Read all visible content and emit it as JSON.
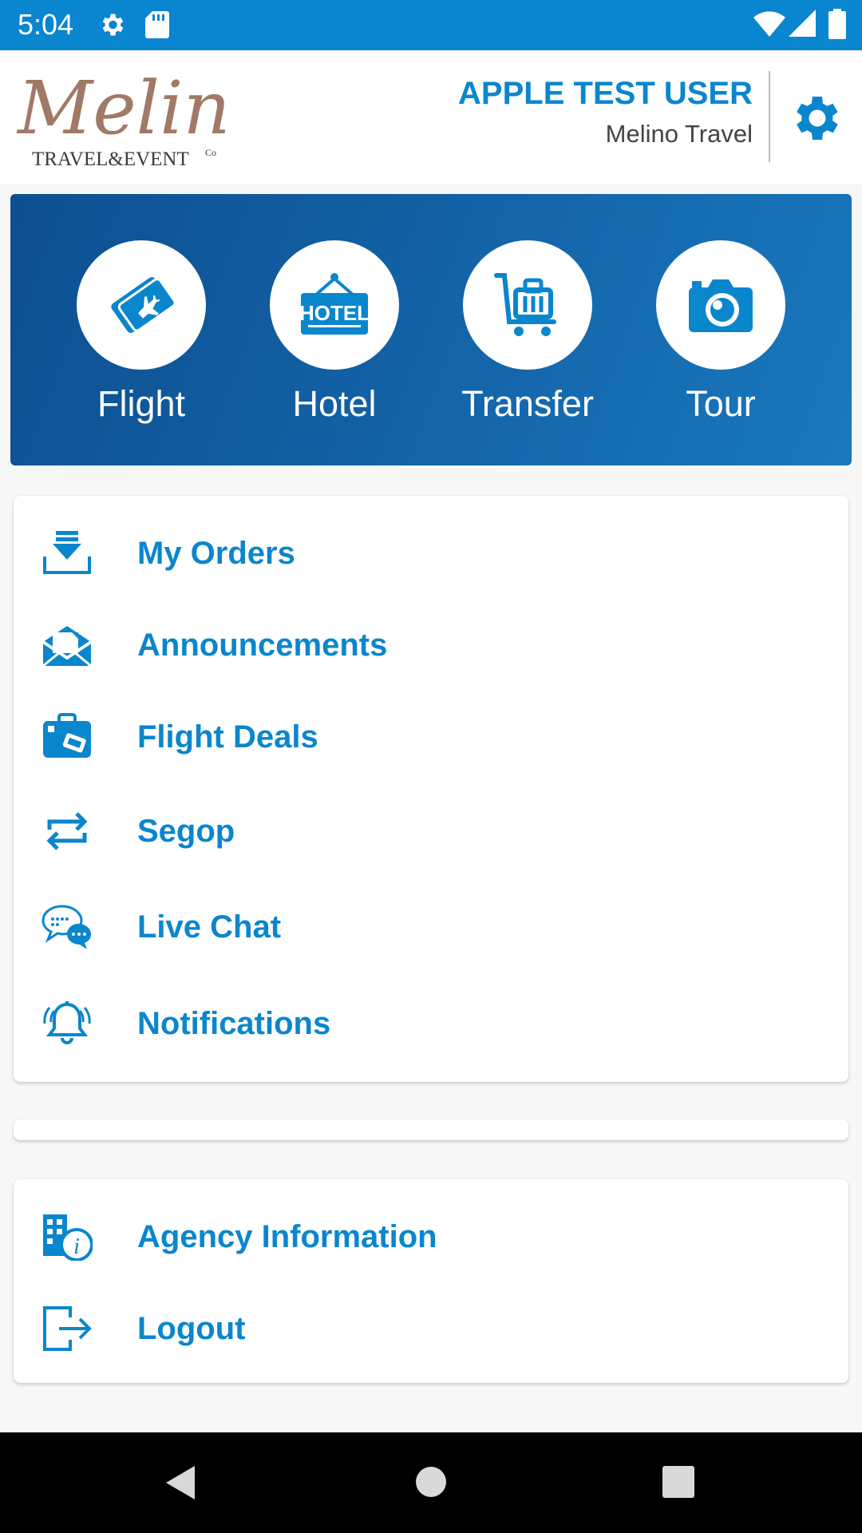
{
  "status_bar": {
    "time": "5:04",
    "icons": [
      "settings-icon",
      "sd-card-icon",
      "wifi-icon",
      "signal-icon",
      "battery-icon"
    ]
  },
  "header": {
    "logo_script": "Melino",
    "logo_tagline": "TRAVEL&EVENT",
    "logo_co": "Co",
    "user_name": "APPLE TEST USER",
    "agency_name": "Melino Travel"
  },
  "services": [
    {
      "label": "Flight",
      "icon": "plane-ticket-icon"
    },
    {
      "label": "Hotel",
      "icon": "hotel-sign-icon",
      "icon_text": "HOTEL"
    },
    {
      "label": "Transfer",
      "icon": "luggage-cart-icon"
    },
    {
      "label": "Tour",
      "icon": "camera-icon"
    }
  ],
  "menu": [
    {
      "label": "My Orders",
      "icon": "download-tray-icon"
    },
    {
      "label": "Announcements",
      "icon": "envelope-open-icon"
    },
    {
      "label": "Flight Deals",
      "icon": "suitcase-tag-icon"
    },
    {
      "label": "Segop",
      "icon": "repeat-arrows-icon"
    },
    {
      "label": "Live Chat",
      "icon": "chat-bubbles-icon"
    },
    {
      "label": "Notifications",
      "icon": "ringing-bell-icon"
    }
  ],
  "menu_secondary": [
    {
      "label": "Agency Information",
      "icon": "building-info-icon"
    },
    {
      "label": "Logout",
      "icon": "logout-icon"
    }
  ],
  "colors": {
    "accent": "#0a86cd",
    "status_bar": "#0a85cf",
    "hero_dark": "#0d4f91",
    "hero_light": "#1a78be",
    "logo_brown": "#a07a66"
  }
}
